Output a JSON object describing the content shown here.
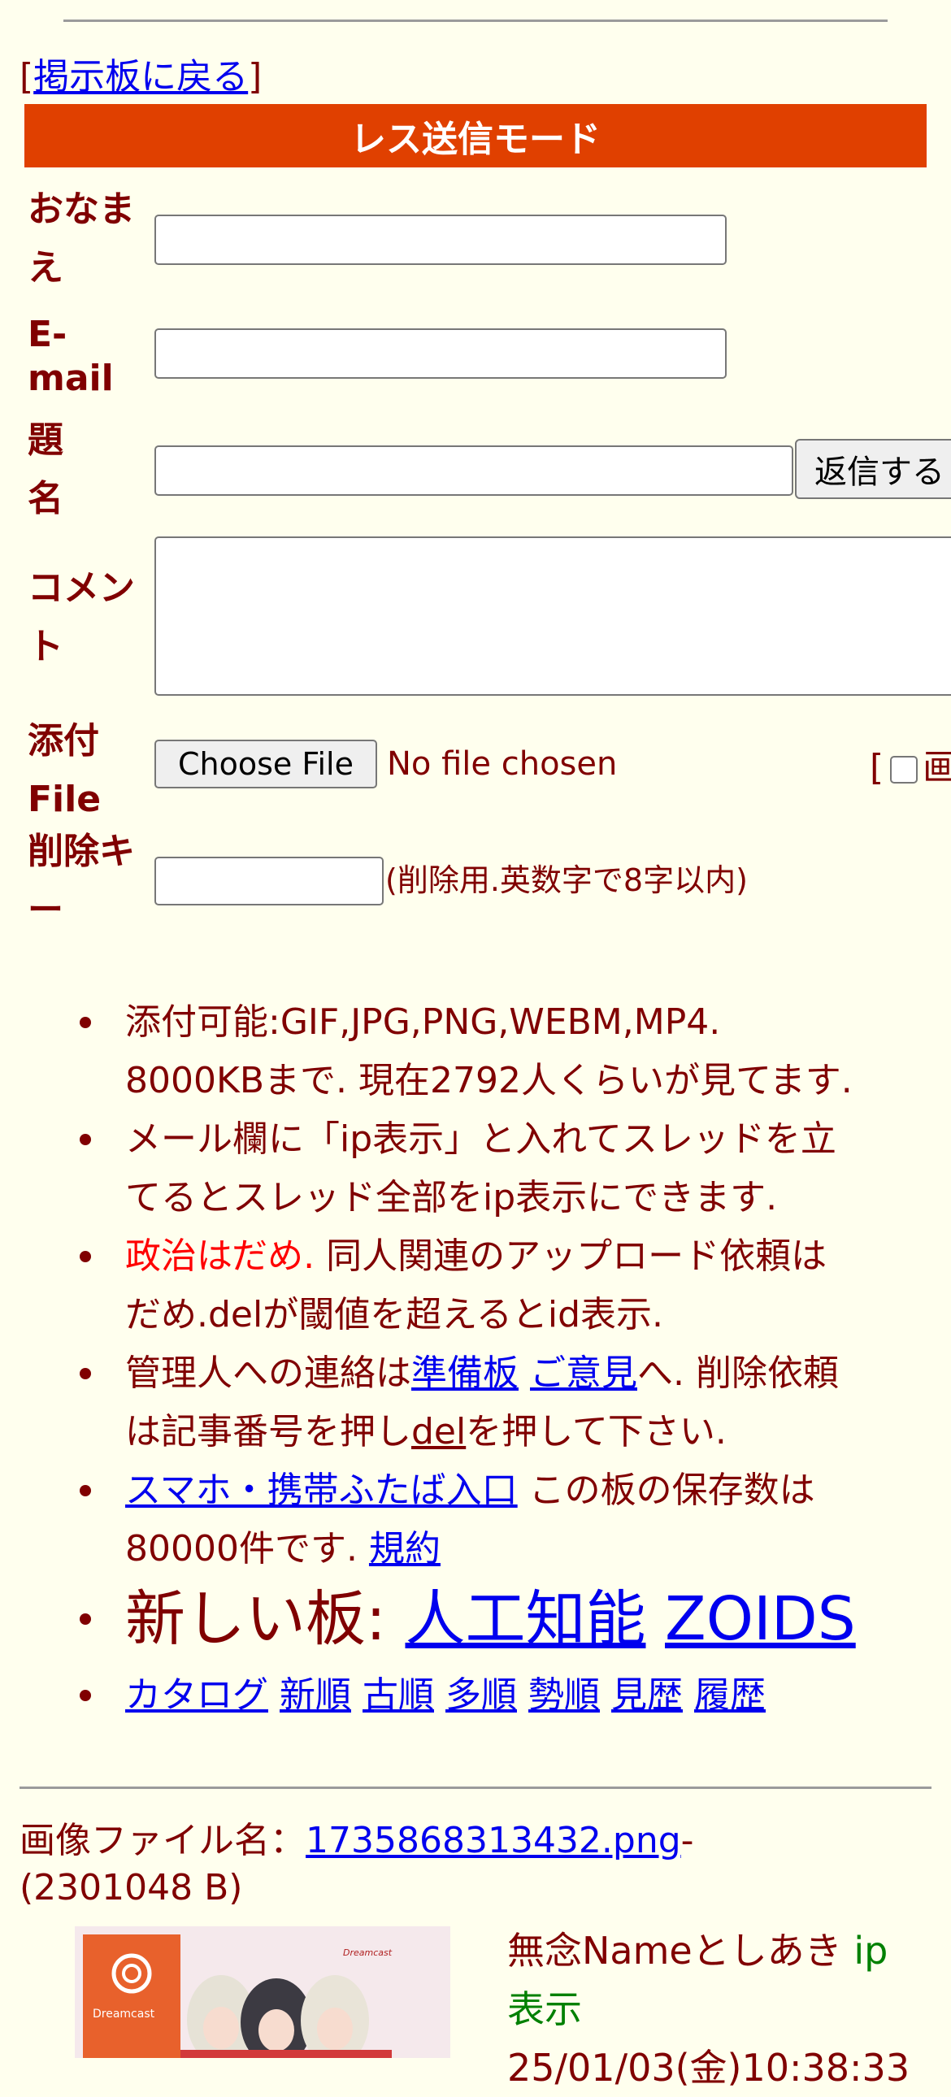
{
  "back": {
    "open": "[",
    "link": "掲示板に戻る",
    "close": "]"
  },
  "form": {
    "title": "レス送信モード",
    "labels": {
      "name": [
        "おなま",
        "え"
      ],
      "email": [
        "E-",
        "mail"
      ],
      "subject": [
        "題",
        "名"
      ],
      "comment": [
        "コメン",
        "ト"
      ],
      "file": [
        "添付",
        "File"
      ],
      "delkey": [
        "削除キ",
        "ー"
      ]
    },
    "submit": "返信する",
    "choose_file": "Choose File",
    "no_file": "No file chosen",
    "image_option_prefix": "[",
    "image_option_label": "画",
    "delkey_note": "(削除用.英数字で8字以内)"
  },
  "rules": {
    "r1a": "添付可能:GIF,JPG,PNG,WEBM,MP4.",
    "r1b": "8000KBまで. 現在2792人くらいが見てます.",
    "r2a": "メール欄に「ip表示」と入れてスレッドを立",
    "r2b": "てるとスレッド全部をip表示にできます.",
    "r3red": "政治はだめ.",
    "r3a": " 同人関連のアップロード依頼は",
    "r3b": "だめ.delが閾値を超えるとid表示.",
    "r4a": "管理人への連絡は",
    "r4link1": "準備板",
    "r4link2": "ご意見",
    "r4c": "へ. 削除依頼",
    "r4d": "は記事番号を押し",
    "r4del": "del",
    "r4e": "を押して下さい.",
    "r5link": "スマホ・携帯ふたば入口",
    "r5a": " この板の保存数は",
    "r5b": "80000件です. ",
    "r5link2": "規約",
    "r6label": "新しい板: ",
    "r6link1": "人工知能",
    "r6link2": "ZOIDS",
    "nav": [
      "カタログ",
      "新順",
      "古順",
      "多順",
      "勢順",
      "見歴",
      "履歴"
    ]
  },
  "file_info": {
    "prefix": "画像ファイル名：",
    "filename": "1735868313432.png",
    "dash": "-",
    "size": "(2301048 B)"
  },
  "post": {
    "subject": "無念",
    "name": "Nameとしあき",
    "ip": "ip",
    "ip2": "表示",
    "date": "25/01/03(金)10:38:33"
  },
  "thumb_texts": {
    "left": "Dreamcast",
    "right": "Dreamcast"
  }
}
